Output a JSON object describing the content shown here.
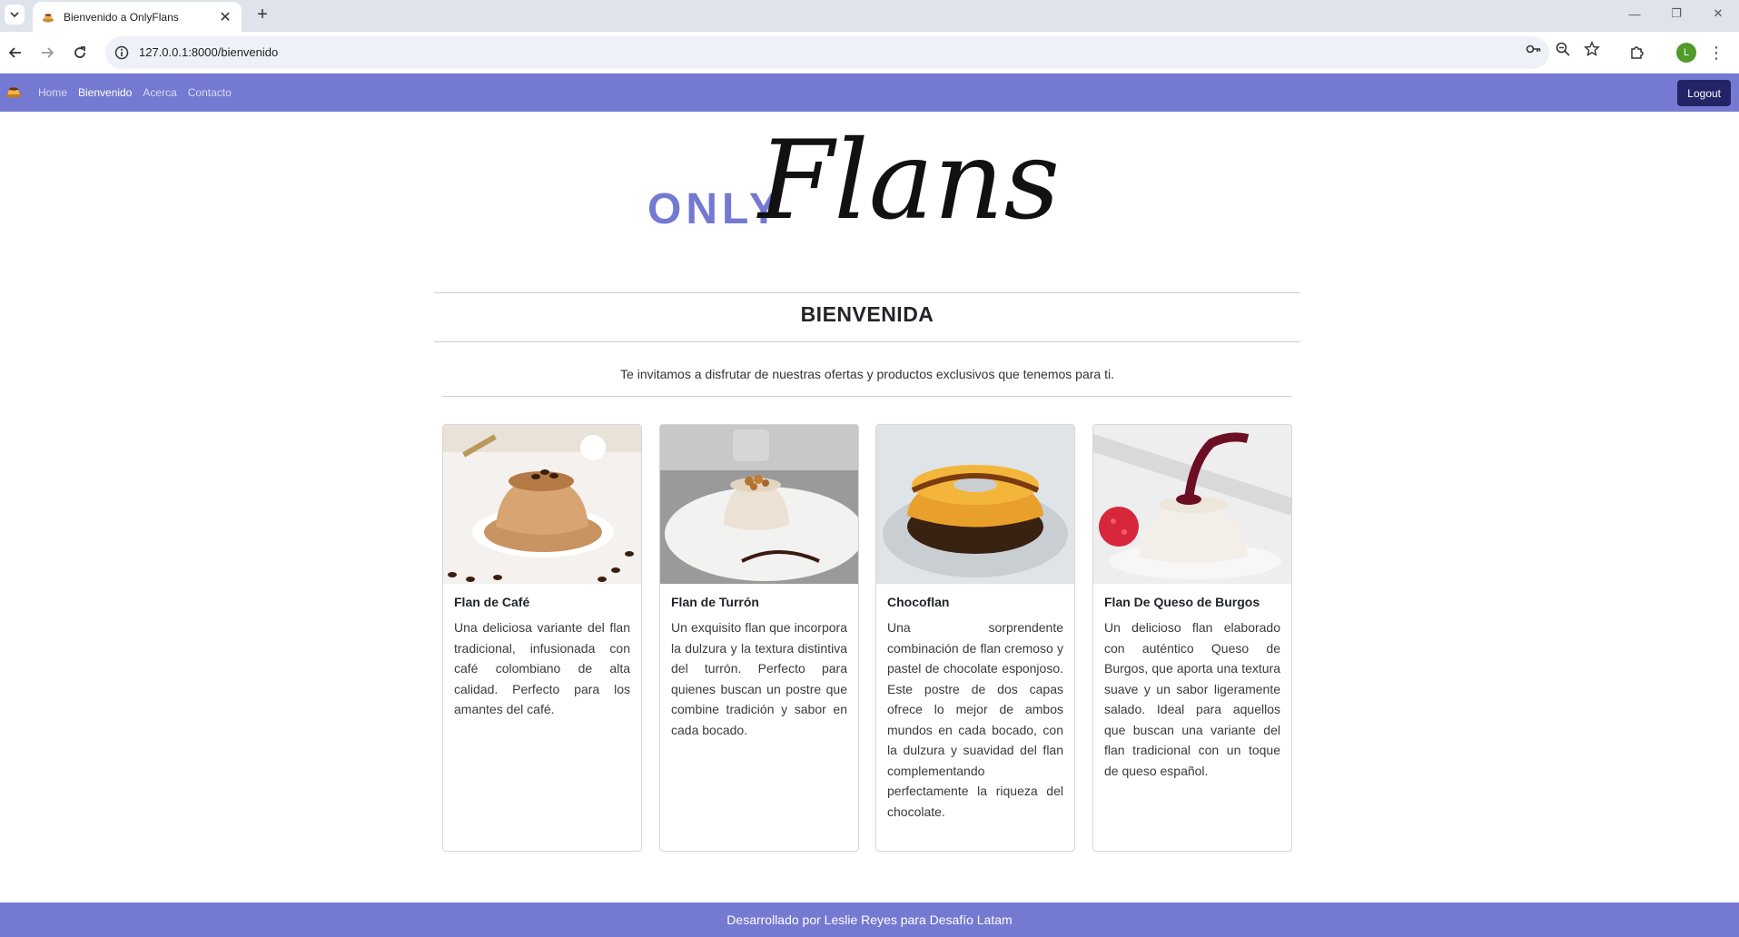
{
  "browser": {
    "tab_title": "Bienvenido a OnlyFlans",
    "url": "127.0.0.1:8000/bienvenido",
    "profile_initial": "L"
  },
  "nav": {
    "links": [
      {
        "label": "Home",
        "active": false
      },
      {
        "label": "Bienvenido",
        "active": true
      },
      {
        "label": "Acerca",
        "active": false
      },
      {
        "label": "Contacto",
        "active": false
      }
    ],
    "logout_label": "Logout"
  },
  "logo": {
    "only": "ONLY",
    "flans": "Flans"
  },
  "welcome": {
    "title": "BIENVENIDA",
    "lead": "Te invitamos a disfrutar de nuestras ofertas y productos exclusivos que tenemos para ti."
  },
  "products": [
    {
      "name": "Flan de Café",
      "description": "Una deliciosa variante del flan tradicional, infusionada con café colombiano de alta calidad. Perfecto para los amantes del café."
    },
    {
      "name": "Flan de Turrón",
      "description": "Un exquisito flan que incorpora la dulzura y la textura distintiva del turrón. Perfecto para quienes buscan un postre que combine tradición y sabor en cada bocado."
    },
    {
      "name": "Chocoflan",
      "description": "Una sorprendente combinación de flan cremoso y pastel de chocolate esponjoso. Este postre de dos capas ofrece lo mejor de ambos mundos en cada bocado, con la dulzura y suavidad del flan complementando perfectamente la riqueza del chocolate."
    },
    {
      "name": "Flan De Queso de Burgos",
      "description": "Un delicioso flan elaborado con auténtico Queso de Burgos, que aporta una textura suave y un sabor ligeramente salado. Ideal para aquellos que buscan una variante del flan tradicional con un toque de queso español."
    }
  ],
  "footer": {
    "text": "Desarrollado por Leslie Reyes para Desafío Latam"
  },
  "colors": {
    "brand": "#7479d1",
    "logout_bg": "#232468"
  }
}
